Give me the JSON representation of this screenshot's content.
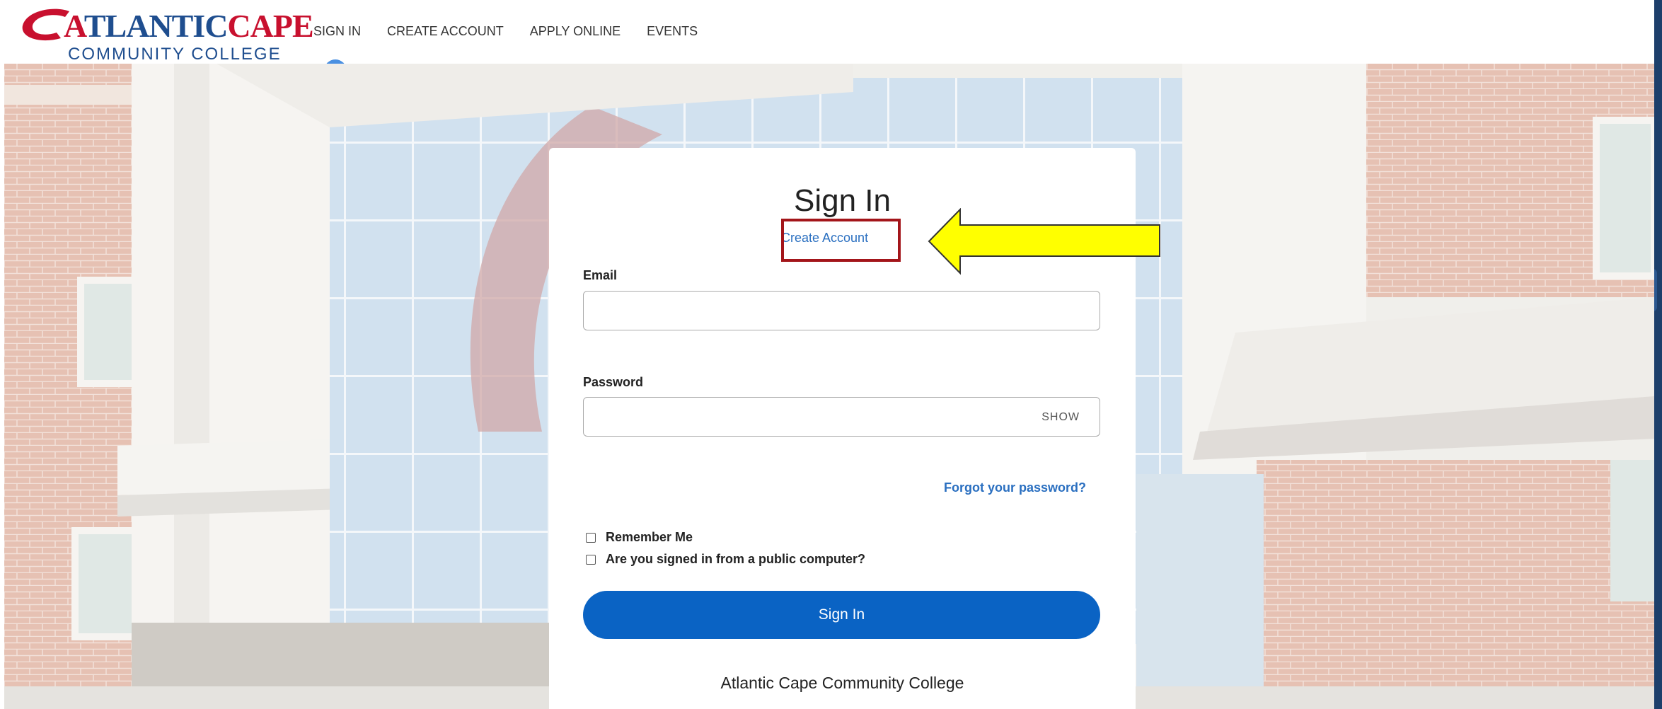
{
  "header": {
    "logo": {
      "top_text_red": "A",
      "top_text_blue": "TLANTIC",
      "top_text_red2": "C",
      "top_text_blue2": "APE",
      "bottom_text": "COMMUNITY COLLEGE"
    },
    "nav": [
      "SIGN IN",
      "CREATE ACCOUNT",
      "APPLY ONLINE",
      "EVENTS"
    ]
  },
  "signin_card": {
    "title": "Sign In",
    "create_account_link": "Create Account",
    "email_label": "Email",
    "email_value": "",
    "password_label": "Password",
    "password_value": "",
    "show_label": "SHOW",
    "forgot_link": "Forgot your password?",
    "remember_me": "Remember Me",
    "public_computer": "Are you signed in from a public computer?",
    "remember_me_checked": false,
    "public_computer_checked": false,
    "submit_label": "Sign In",
    "footer_text": "Atlantic Cape Community College"
  },
  "colors": {
    "brand_blue": "#1f4e8f",
    "brand_red": "#c8102e",
    "button_blue": "#0a63c4",
    "link_blue": "#2a6fc0",
    "highlight_red": "#a3151a",
    "arrow_yellow": "#ffff00"
  }
}
